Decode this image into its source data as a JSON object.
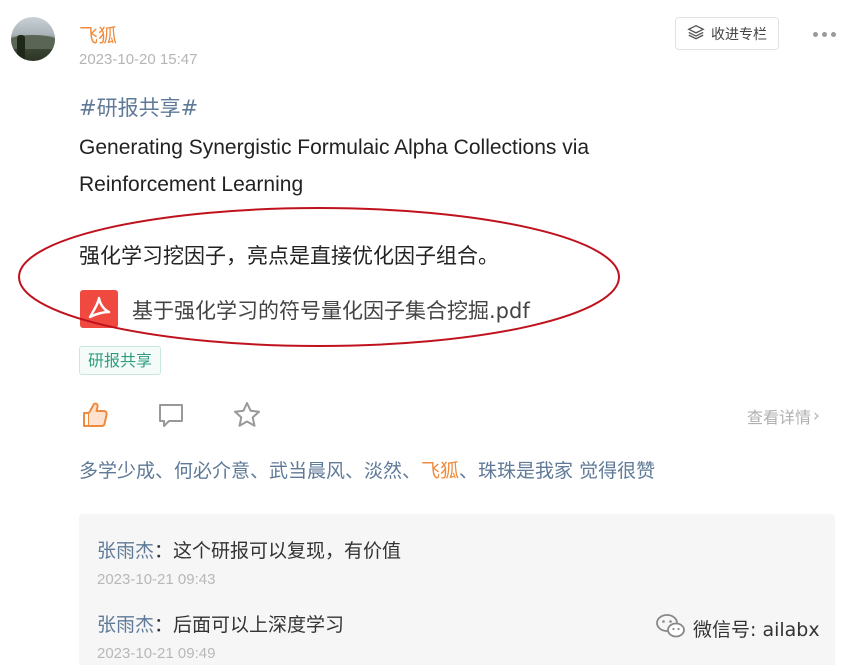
{
  "post": {
    "author": "飞狐",
    "time": "2023-10-20 15:47",
    "collect_label": "收进专栏",
    "hashtag": "#研报共享#",
    "title": "Generating Synergistic Formulaic Alpha Collections via Reinforcement Learning",
    "summary": "强化学习挖因子，亮点是直接优化因子组合。",
    "attachment_name": "基于强化学习的符号量化因子集合挖掘.pdf",
    "tag": "研报共享"
  },
  "actions": {
    "detail_label": "查看详情",
    "detail_chevron": "›"
  },
  "likes": {
    "names_before": "多学少成、何必介意、武当晨风、淡然、",
    "highlight": "飞狐",
    "names_after": "、珠珠是我家 觉得很赞"
  },
  "comments": [
    {
      "name": "张雨杰",
      "sep": "：",
      "text": "这个研报可以复现，有价值",
      "time": "2023-10-21 09:43"
    },
    {
      "name": "张雨杰",
      "sep": "：",
      "text": "后面可以上深度学习",
      "time": "2023-10-21 09:49"
    }
  ],
  "watermark": {
    "label": "微信号: ailabx"
  },
  "colors": {
    "accent": "#f08a3c",
    "link": "#5f7a98",
    "annotation": "#c0121e",
    "pdf": "#f04a40"
  },
  "icons": [
    "more-icon",
    "collect-icon",
    "pdf-icon",
    "like-icon",
    "comment-icon",
    "star-icon",
    "wechat-icon"
  ]
}
